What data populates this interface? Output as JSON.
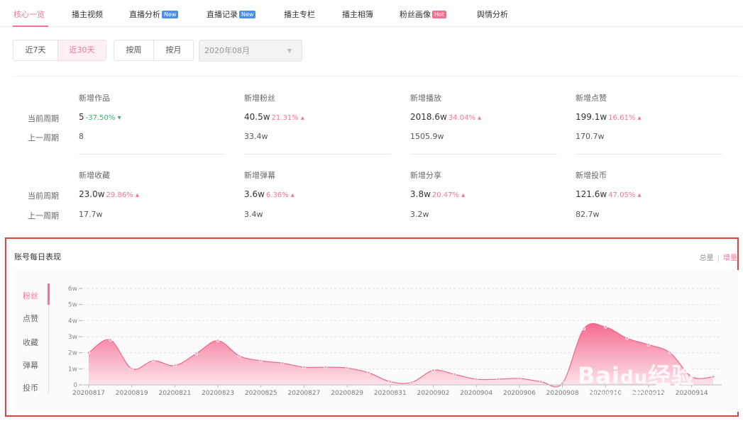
{
  "nav": {
    "items": [
      {
        "label": "核心一览",
        "badge": "",
        "active": true
      },
      {
        "label": "播主视频",
        "badge": ""
      },
      {
        "label": "直播分析",
        "badge": "New"
      },
      {
        "label": "直播记录",
        "badge": "New"
      },
      {
        "label": "播主专栏",
        "badge": ""
      },
      {
        "label": "播主相簿",
        "badge": ""
      },
      {
        "label": "粉丝画像",
        "badge": "Hot"
      },
      {
        "label": "舆情分析",
        "badge": ""
      }
    ]
  },
  "filters": {
    "range": [
      "近7天",
      "近30天"
    ],
    "period": [
      "按周",
      "按月"
    ],
    "month": "2020年08月"
  },
  "metrics": {
    "current_label": "当前周期",
    "previous_label": "上一周期",
    "items": [
      {
        "title": "新增作品",
        "current": "5",
        "change": "-37.50%",
        "dir": "down",
        "previous": "8"
      },
      {
        "title": "新增粉丝",
        "current": "40.5w",
        "change": "21.31%",
        "dir": "up",
        "previous": "33.4w"
      },
      {
        "title": "新增播放",
        "current": "2018.6w",
        "change": "34.04%",
        "dir": "up",
        "previous": "1505.9w"
      },
      {
        "title": "新增点赞",
        "current": "199.1w",
        "change": "16.61%",
        "dir": "up",
        "previous": "170.7w"
      },
      {
        "title": "新增收藏",
        "current": "23.0w",
        "change": "29.86%",
        "dir": "up",
        "previous": "17.7w"
      },
      {
        "title": "新增弹幕",
        "current": "3.6w",
        "change": "6.36%",
        "dir": "up",
        "previous": "3.4w"
      },
      {
        "title": "新增分享",
        "current": "3.8w",
        "change": "20.47%",
        "dir": "up",
        "previous": "3.2w"
      },
      {
        "title": "新增投币",
        "current": "121.6w",
        "change": "47.05%",
        "dir": "up",
        "previous": "82.7w"
      }
    ]
  },
  "chart_section": {
    "title": "账号每日表现",
    "link_total": "总量",
    "link_incr": "增量",
    "tabs": [
      "粉丝",
      "点赞",
      "收藏",
      "弹幕",
      "投币"
    ],
    "watermark": "Bai",
    "watermark_paw": "du",
    "watermark_cn": "经验",
    "watermark_sub": "jingyan.baidu.com"
  },
  "colors": {
    "accent": "#fb7299",
    "down": "#35b26a",
    "highlight": "#d9453e"
  },
  "chart_data": {
    "type": "area",
    "x": [
      "20200817",
      "20200818",
      "20200819",
      "20200820",
      "20200821",
      "20200822",
      "20200823",
      "20200824",
      "20200825",
      "20200826",
      "20200827",
      "20200828",
      "20200829",
      "20200830",
      "20200831",
      "20200901",
      "20200902",
      "20200903",
      "20200904",
      "20200905",
      "20200906",
      "20200907",
      "20200908",
      "20200909",
      "20200910",
      "20200911",
      "20200912",
      "20200913",
      "20200914",
      "20200915"
    ],
    "xticks": [
      "20200817",
      "20200819",
      "20200821",
      "20200823",
      "20200825",
      "20200827",
      "20200829",
      "20200831",
      "20200902",
      "20200904",
      "20200906",
      "20200908",
      "20200910",
      "20200912",
      "20200914"
    ],
    "yticks": [
      "0",
      "1w",
      "2w",
      "3w",
      "4w",
      "5w",
      "6w"
    ],
    "ylim": [
      0,
      60000
    ],
    "series": [
      {
        "values": [
          20000,
          28000,
          10000,
          15000,
          12000,
          19500,
          27500,
          18000,
          15000,
          13500,
          11000,
          11000,
          10500,
          7500,
          2000,
          1500,
          9000,
          6500,
          3500,
          3500,
          4000,
          2000,
          1000,
          35000,
          36000,
          29000,
          25000,
          20000,
          5000,
          5000
        ]
      }
    ]
  }
}
